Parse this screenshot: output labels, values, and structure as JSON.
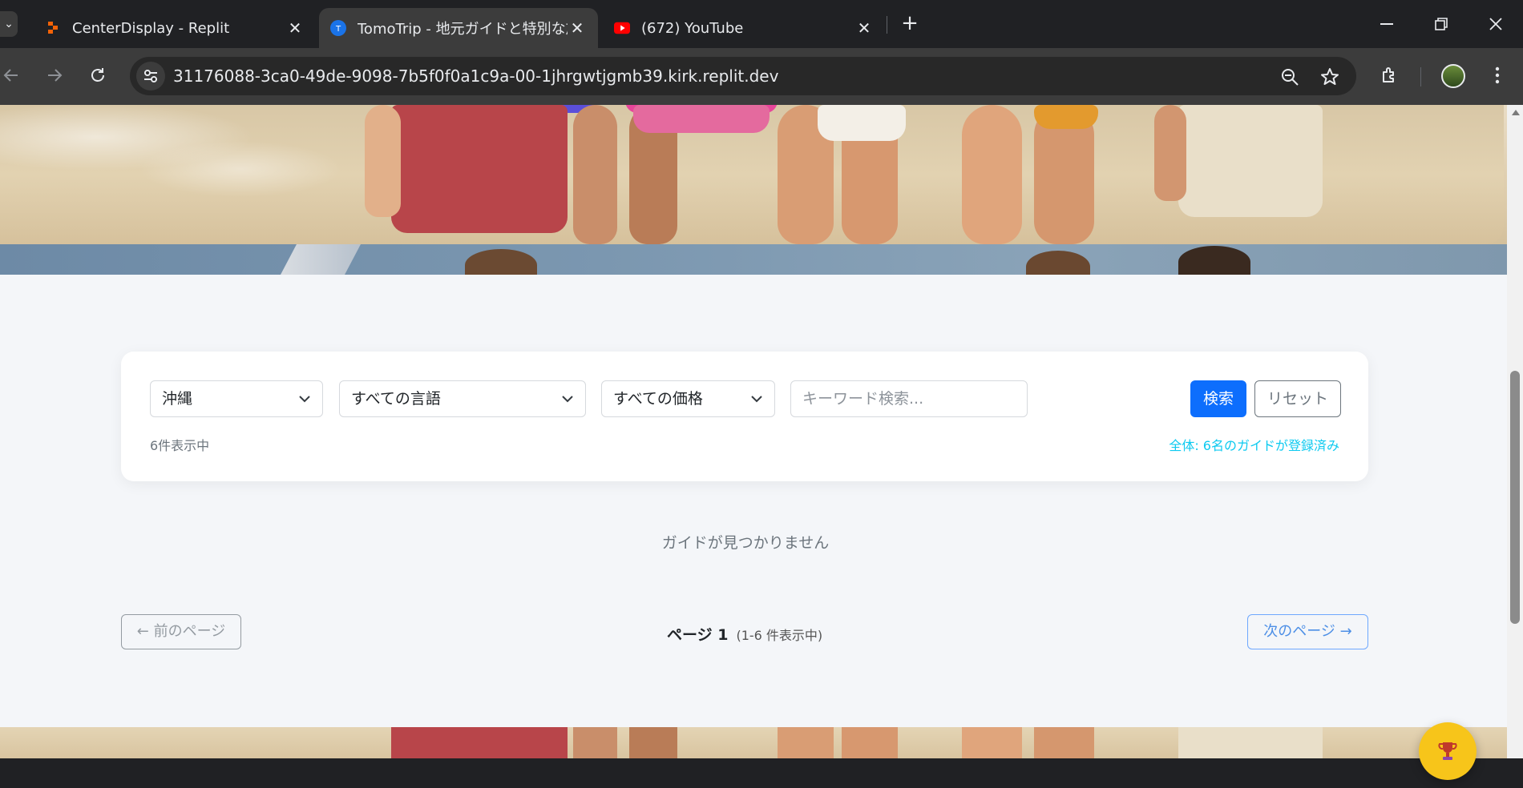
{
  "browser": {
    "tabs": [
      {
        "title": "CenterDisplay - Replit",
        "favicon": "replit-icon"
      },
      {
        "title": "TomoTrip - 地元ガイドと特別な旅",
        "favicon": "tomotrip-icon"
      },
      {
        "title": "(672) YouTube",
        "favicon": "youtube-icon"
      }
    ],
    "url": "31176088-3ca0-49de-9098-7b5f0f0a1c9a-00-1jhrgwtjgmb39.kirk.replit.dev"
  },
  "filters": {
    "region": "沖縄",
    "language": "すべての言語",
    "price": "すべての価格",
    "keyword_placeholder": "キーワード検索...",
    "search_label": "検索",
    "reset_label": "リセット",
    "count_text": "6件表示中",
    "total_text": "全体: 6名のガイドが登録済み"
  },
  "results": {
    "empty_message": "ガイドが見つかりません"
  },
  "pagination": {
    "prev_label": "← 前のページ",
    "page_label": "ページ 1",
    "range_label": "(1-6 件表示中)",
    "next_label": "次のページ →"
  },
  "colors": {
    "primary": "#0d6efd",
    "info": "#0dcaf0",
    "trophy": "#f7c51a"
  }
}
